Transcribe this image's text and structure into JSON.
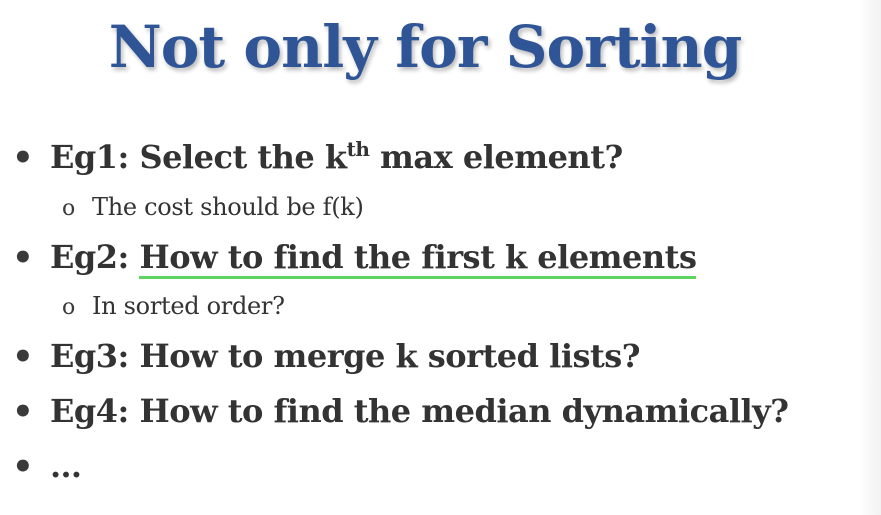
{
  "slide": {
    "title": "Not only for Sorting",
    "items": [
      {
        "bullet": "•",
        "prefix": "Eg1: Select the k",
        "sup": "th",
        "suffix": " max element?",
        "sub_bullet": "o",
        "sub": "The cost should be f(k)"
      },
      {
        "bullet": "•",
        "prefix": "Eg2: ",
        "underlined": "How to find the first k elements",
        "sub_bullet": "o",
        "sub": "In sorted order?"
      },
      {
        "bullet": "•",
        "text": "Eg3: How to merge k sorted lists?"
      },
      {
        "bullet": "•",
        "text": "Eg4: How to find the median dynamically?"
      },
      {
        "bullet": "•",
        "text": "…"
      }
    ]
  },
  "colors": {
    "title": "#2f5597",
    "body_text": "#333333",
    "underline": "#5fd35f"
  }
}
